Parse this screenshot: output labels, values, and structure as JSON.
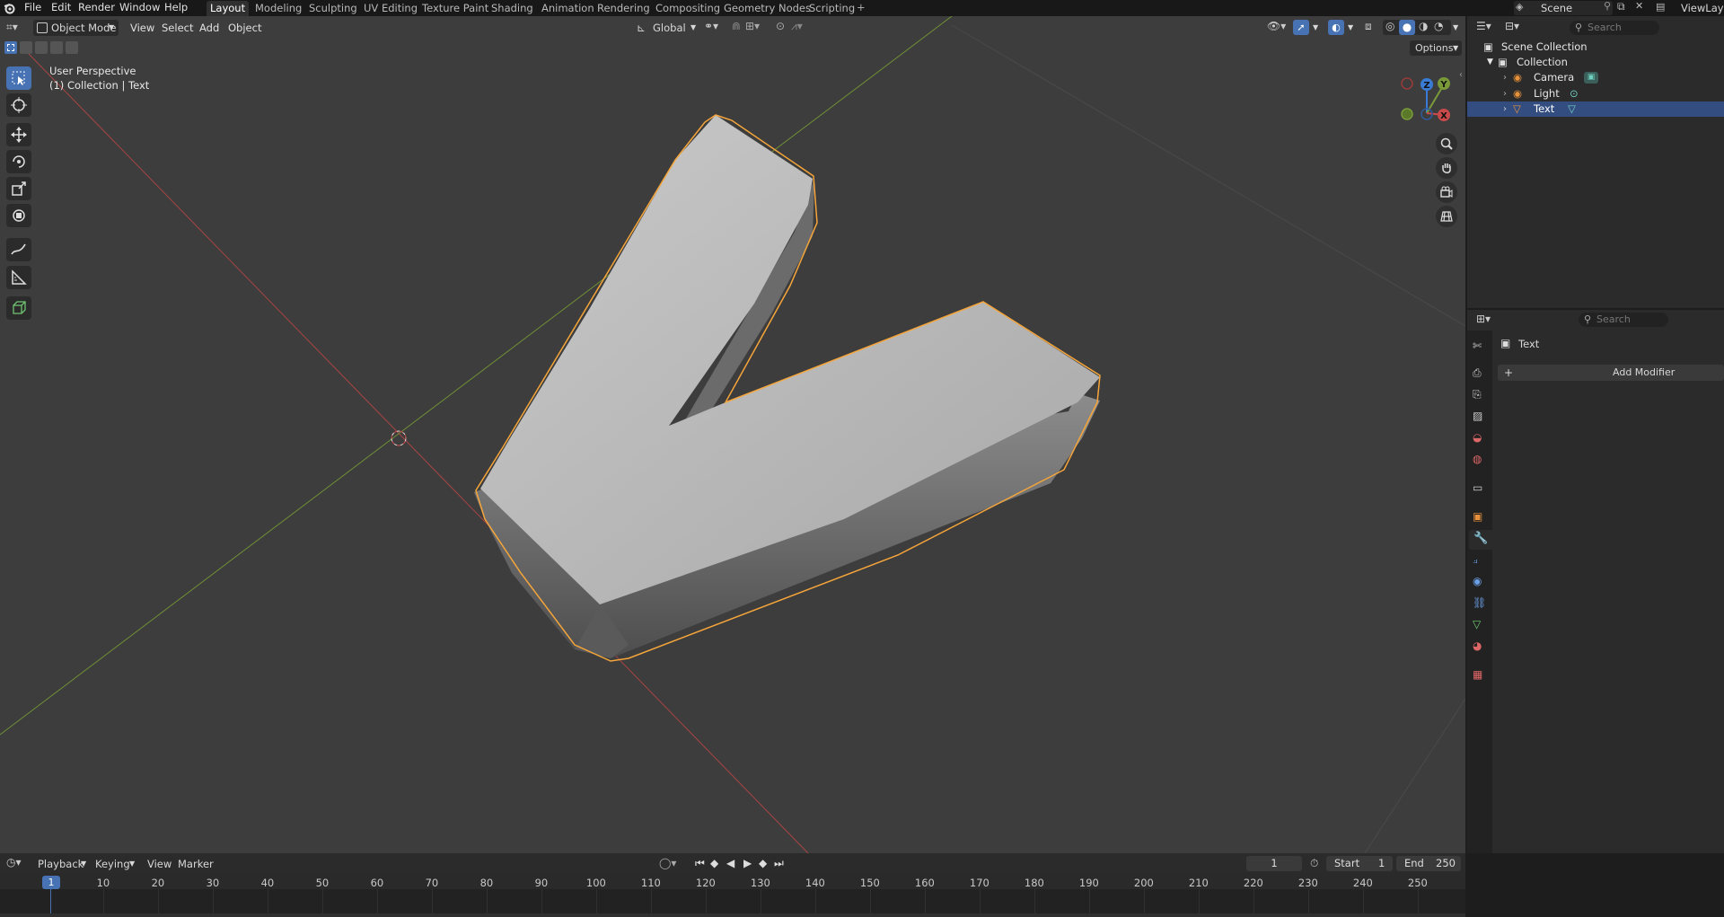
{
  "menu": [
    "File",
    "Edit",
    "Render",
    "Window",
    "Help"
  ],
  "workspaces": [
    {
      "label": "Layout",
      "active": true
    },
    {
      "label": "Modeling"
    },
    {
      "label": "Sculpting"
    },
    {
      "label": "UV Editing"
    },
    {
      "label": "Texture Paint"
    },
    {
      "label": "Shading"
    },
    {
      "label": "Animation"
    },
    {
      "label": "Rendering"
    },
    {
      "label": "Compositing"
    },
    {
      "label": "Geometry Nodes"
    },
    {
      "label": "Scripting"
    }
  ],
  "topright": {
    "scene": "Scene",
    "view_layer": "ViewLayer"
  },
  "viewport_header": {
    "mode": "Object Mode",
    "menus": [
      "View",
      "Select",
      "Add",
      "Object"
    ],
    "transform_orientation": "Global",
    "options": "Options"
  },
  "overlay_text": {
    "line1": "User Perspective",
    "line2": "(1) Collection | Text"
  },
  "gizmo": {
    "z": "Z",
    "y": "Y",
    "x": "X"
  },
  "outliner": {
    "search_placeholder": "Search",
    "scene_collection": "Scene Collection",
    "collection": "Collection",
    "items": [
      {
        "label": "Camera",
        "selected": false
      },
      {
        "label": "Light",
        "selected": false
      },
      {
        "label": "Text",
        "selected": true
      }
    ]
  },
  "properties": {
    "search_placeholder": "Search",
    "object_name": "Text",
    "add_modifier": "Add Modifier"
  },
  "timeline": {
    "menus": [
      "Playback",
      "Keying",
      "View",
      "Marker"
    ],
    "current_frame": "1",
    "start_label": "Start",
    "start": "1",
    "end_label": "End",
    "end": "250",
    "ticks": [
      "1",
      "10",
      "20",
      "30",
      "40",
      "50",
      "60",
      "70",
      "80",
      "90",
      "100",
      "110",
      "120",
      "130",
      "140",
      "150",
      "160",
      "170",
      "180",
      "190",
      "200",
      "210",
      "220",
      "230",
      "240",
      "250"
    ]
  },
  "colors": {
    "accent": "#4772b3",
    "selection_outline": "#f5a53a",
    "x_axis": "#c04a4a",
    "y_axis": "#7a9a3a"
  }
}
